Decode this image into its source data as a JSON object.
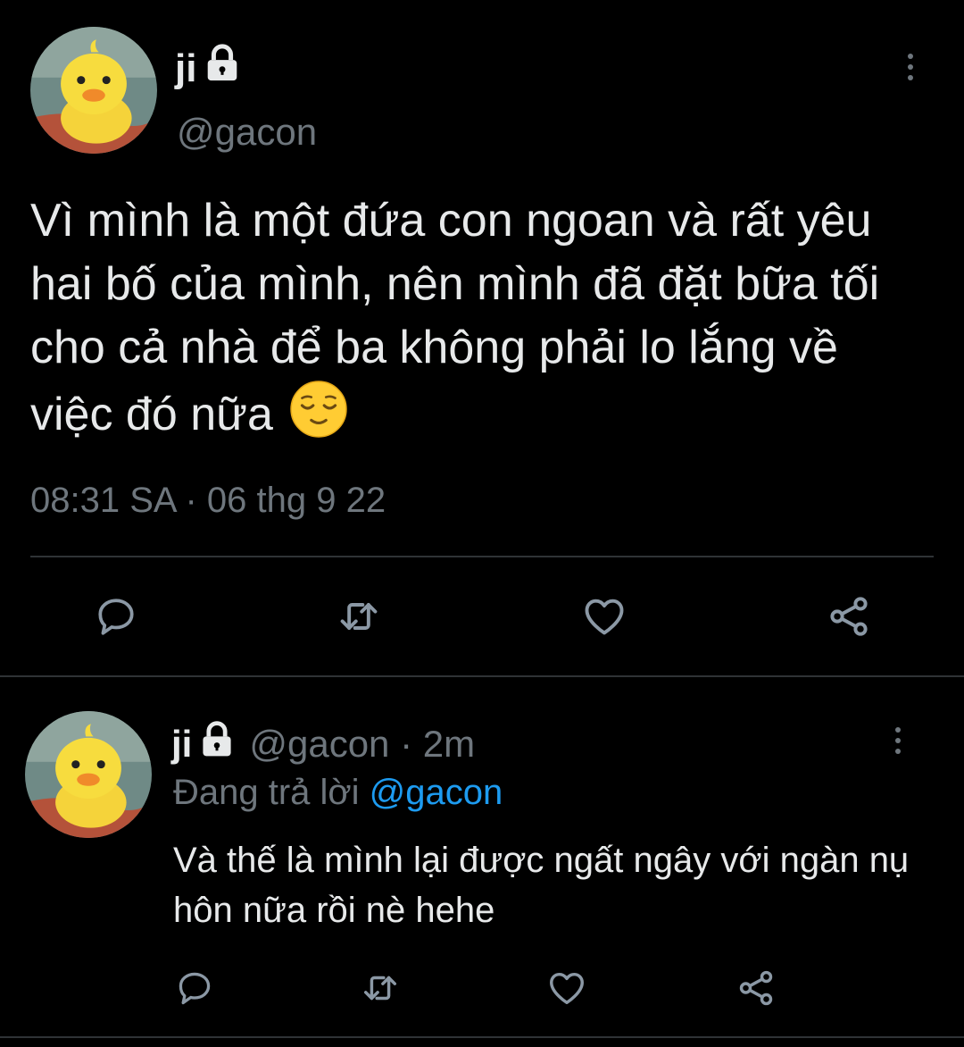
{
  "tweet": {
    "author_name": "ji",
    "author_handle": "@gacon",
    "text": "Vì mình là một đứa con ngoan và rất yêu hai bố của mình, nên mình đã đặt bữa tối cho cả nhà để ba không phải lo lắng về việc đó nữa",
    "emoji": "relieved-face-emoji",
    "time": "08:31 SA",
    "separator": " · ",
    "date": "06 thg 9 22",
    "actions": [
      "reply-icon",
      "retweet-icon",
      "like-icon",
      "share-icon"
    ]
  },
  "reply": {
    "author_name": "ji",
    "author_handle": "@gacon",
    "separator": " · ",
    "age": "2m",
    "replying_prefix": "Đang trả lời ",
    "replying_to": "@gacon",
    "text": "Và thế là mình lại được ngất ngây với ngàn nụ hôn nữa rồi nè hehe",
    "actions": [
      "reply-icon",
      "retweet-icon",
      "like-icon",
      "share-icon"
    ]
  },
  "colors": {
    "background": "#000000",
    "text": "#e7e9ea",
    "muted": "#6e767d",
    "link": "#1d9bf0",
    "divider": "#2f3336"
  }
}
